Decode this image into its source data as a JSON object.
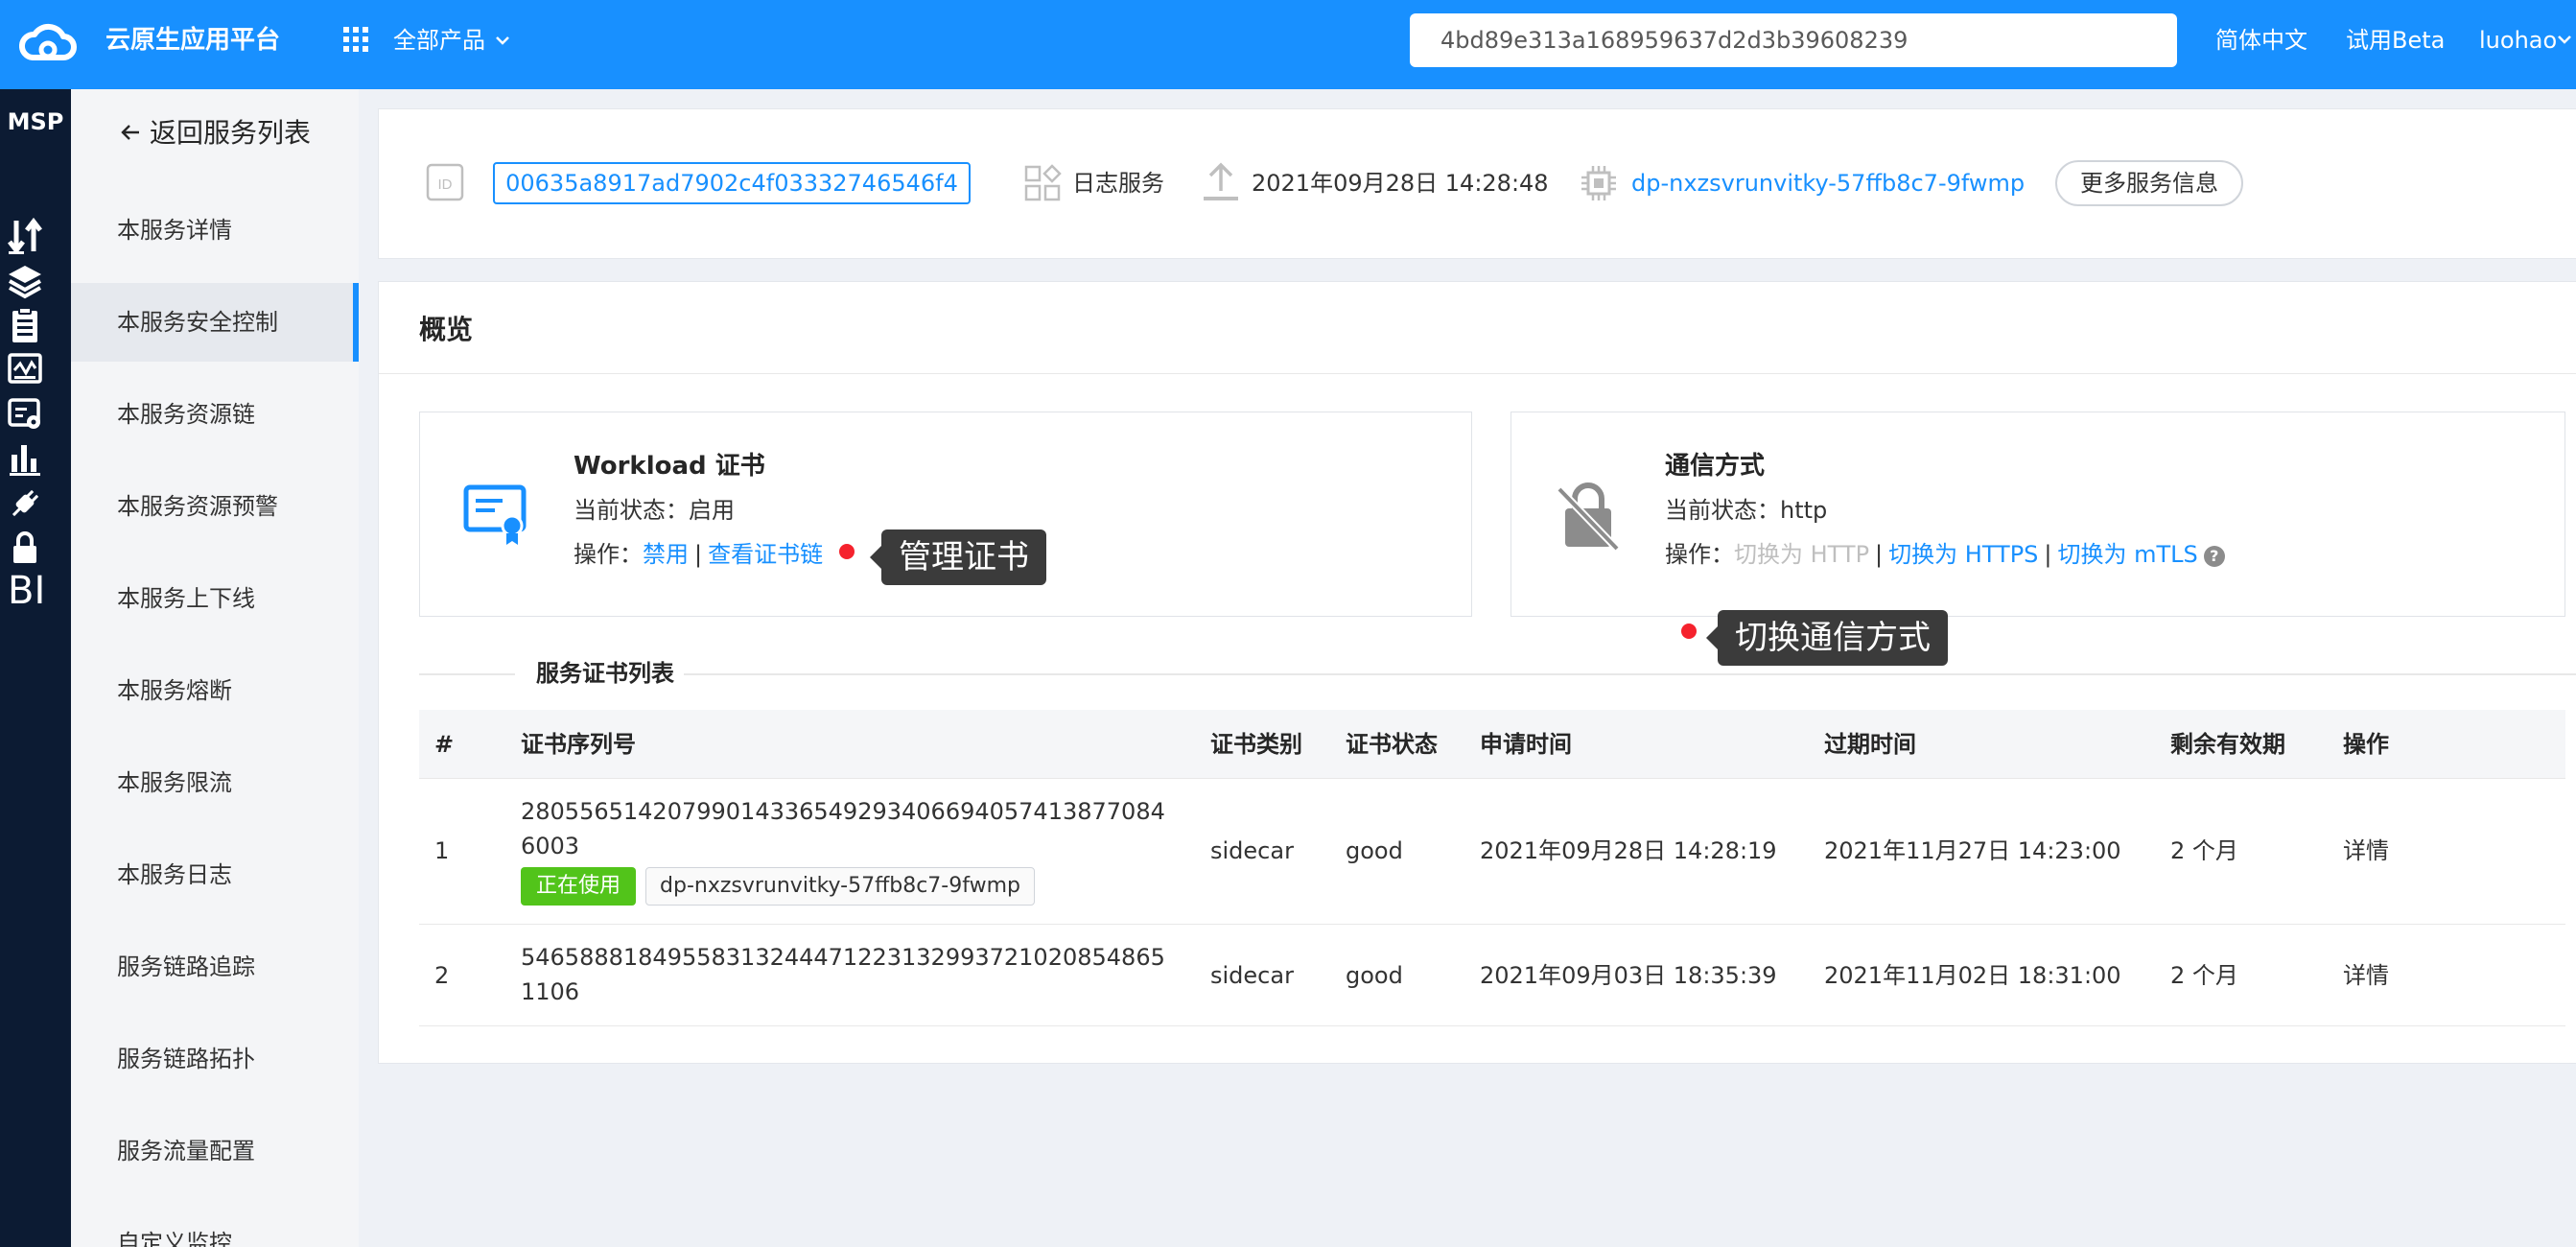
{
  "topbar": {
    "title": "云原生应用平台",
    "all_products": "全部产品",
    "search_value": "4bd89e313a168959637d2d3b39608239",
    "language": "简体中文",
    "beta": "试用Beta",
    "user": "luohao"
  },
  "rail": {
    "title": "MSP",
    "bi_label": "BI"
  },
  "subnav": {
    "back_label": "返回服务列表",
    "items": [
      {
        "label": "本服务详情"
      },
      {
        "label": "本服务安全控制"
      },
      {
        "label": "本服务资源链"
      },
      {
        "label": "本服务资源预警"
      },
      {
        "label": "本服务上下线"
      },
      {
        "label": "本服务熔断"
      },
      {
        "label": "本服务限流"
      },
      {
        "label": "本服务日志"
      },
      {
        "label": "服务链路追踪"
      },
      {
        "label": "服务链路拓扑"
      },
      {
        "label": "服务流量配置"
      },
      {
        "label": "自定义监控"
      }
    ]
  },
  "info_bar": {
    "id_label": "ID",
    "id_value": "00635a8917ad7902c4f03332746546f4",
    "service_type": "日志服务",
    "created_time": "2021年09月28日 14:28:48",
    "deployment": "dp-nxzsvrunvitky-57ffb8c7-9fwmp",
    "more_button": "更多服务信息"
  },
  "overview": {
    "title": "概览",
    "workload_card": {
      "title": "Workload 证书",
      "status_label": "当前状态：",
      "status_value": "启用",
      "ops_label": "操作：",
      "disable": "禁用",
      "separator": "|",
      "view_chain": "查看证书链"
    },
    "comm_card": {
      "title": "通信方式",
      "status_label": "当前状态：",
      "status_value": "http",
      "ops_label": "操作：",
      "to_http": "切换为 HTTP",
      "separator": "|",
      "to_https": "切换为 HTTPS",
      "to_mtls": "切换为 mTLS",
      "help": "?"
    },
    "tooltip_manage": "管理证书",
    "tooltip_switch": "切换通信方式"
  },
  "cert_list": {
    "title": "服务证书列表",
    "columns": [
      "#",
      "证书序列号",
      "证书类别",
      "证书状态",
      "申请时间",
      "过期时间",
      "剩余有效期",
      "操作"
    ],
    "rows": [
      {
        "index": "1",
        "serial": "280556514207990143365492934066940574138770846003",
        "in_use_tag": "正在使用",
        "pod_tag": "dp-nxzsvrunvitky-57ffb8c7-9fwmp",
        "type": "sidecar",
        "status": "good",
        "applied": "2021年09月28日 14:28:19",
        "expires": "2021年11月27日 14:23:00",
        "remaining": "2 个月",
        "action": "详情"
      },
      {
        "index": "2",
        "serial": "546588818495583132444712231329937210208548651106",
        "type": "sidecar",
        "status": "good",
        "applied": "2021年09月03日 18:35:39",
        "expires": "2021年11月02日 18:31:00",
        "remaining": "2 个月",
        "action": "详情"
      }
    ]
  },
  "colors": {
    "primary": "#1890ff",
    "rail_bg": "#0c1b33",
    "success": "#52c41a",
    "danger_dot": "#f5222d"
  }
}
